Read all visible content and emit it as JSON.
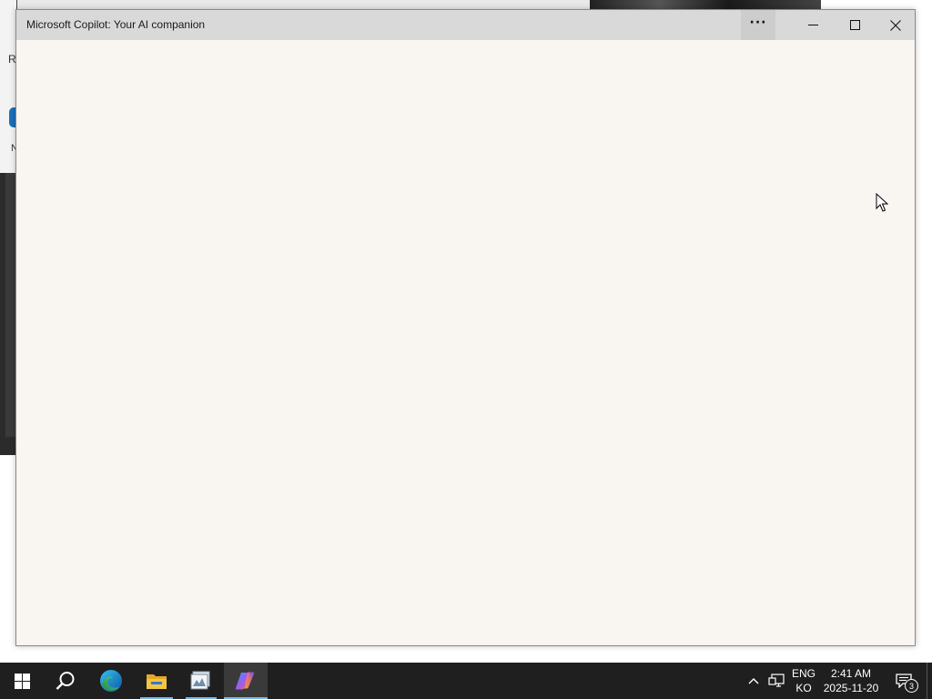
{
  "background": {
    "left_fragment_top": "R",
    "left_fragment_mid": "N"
  },
  "window": {
    "title": "Microsoft Copilot: Your AI companion",
    "more_label": "···",
    "controls": {
      "minimize": "minimize-icon",
      "maximize": "maximize-icon",
      "close": "close-icon"
    },
    "content_background": "#f9f5f1"
  },
  "taskbar": {
    "apps": [
      {
        "name": "Start",
        "icon": "windows-logo-icon"
      },
      {
        "name": "Search",
        "icon": "search-icon"
      },
      {
        "name": "Microsoft Edge",
        "icon": "edge-icon"
      },
      {
        "name": "File Explorer",
        "icon": "folder-icon"
      },
      {
        "name": "App",
        "icon": "app-icon"
      },
      {
        "name": "Microsoft Copilot",
        "icon": "copilot-icon",
        "active": true
      }
    ],
    "tray": {
      "lang_line1": "ENG",
      "lang_line2": "KO",
      "time": "2:41 AM",
      "date": "2025-11-20",
      "notification_count": "3"
    }
  },
  "colors": {
    "taskbar": "#1f1f1f",
    "titlebar": "#d9d9d9",
    "accent_underline": "#76b9ed"
  }
}
